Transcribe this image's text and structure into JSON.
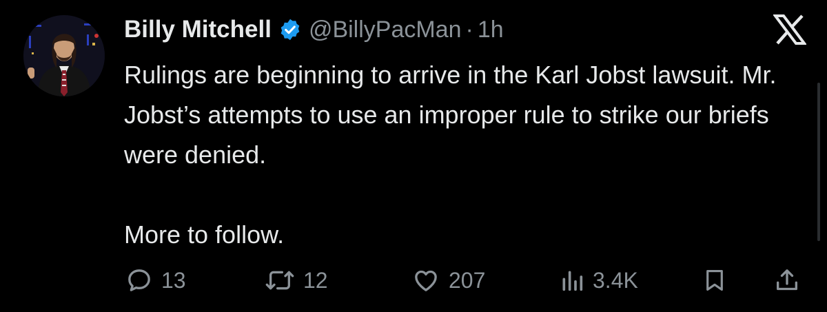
{
  "tweet": {
    "author_name": "Billy Mitchell",
    "handle": "@BillyPacMan",
    "separator": "·",
    "timestamp": "1h",
    "verified": true,
    "text_paragraph_1": "Rulings are beginning to arrive in the Karl Jobst lawsuit. Mr. Jobst’s attempts to use an improper rule to strike our briefs were denied.",
    "text_paragraph_2": "More to follow."
  },
  "actions": {
    "replies": "13",
    "reposts": "12",
    "likes": "207",
    "views": "3.4K"
  },
  "icons": {
    "avatar": "profile-photo",
    "verified": "verified-badge-icon",
    "brand": "x-logo-icon",
    "reply": "reply-icon",
    "repost": "repost-icon",
    "like": "heart-icon",
    "views": "views-icon",
    "bookmark": "bookmark-icon",
    "share": "share-icon"
  },
  "colors": {
    "background": "#000000",
    "primary_text": "#e7e9ea",
    "secondary_text": "#8b9298",
    "verified_blue": "#1d9bf0"
  }
}
